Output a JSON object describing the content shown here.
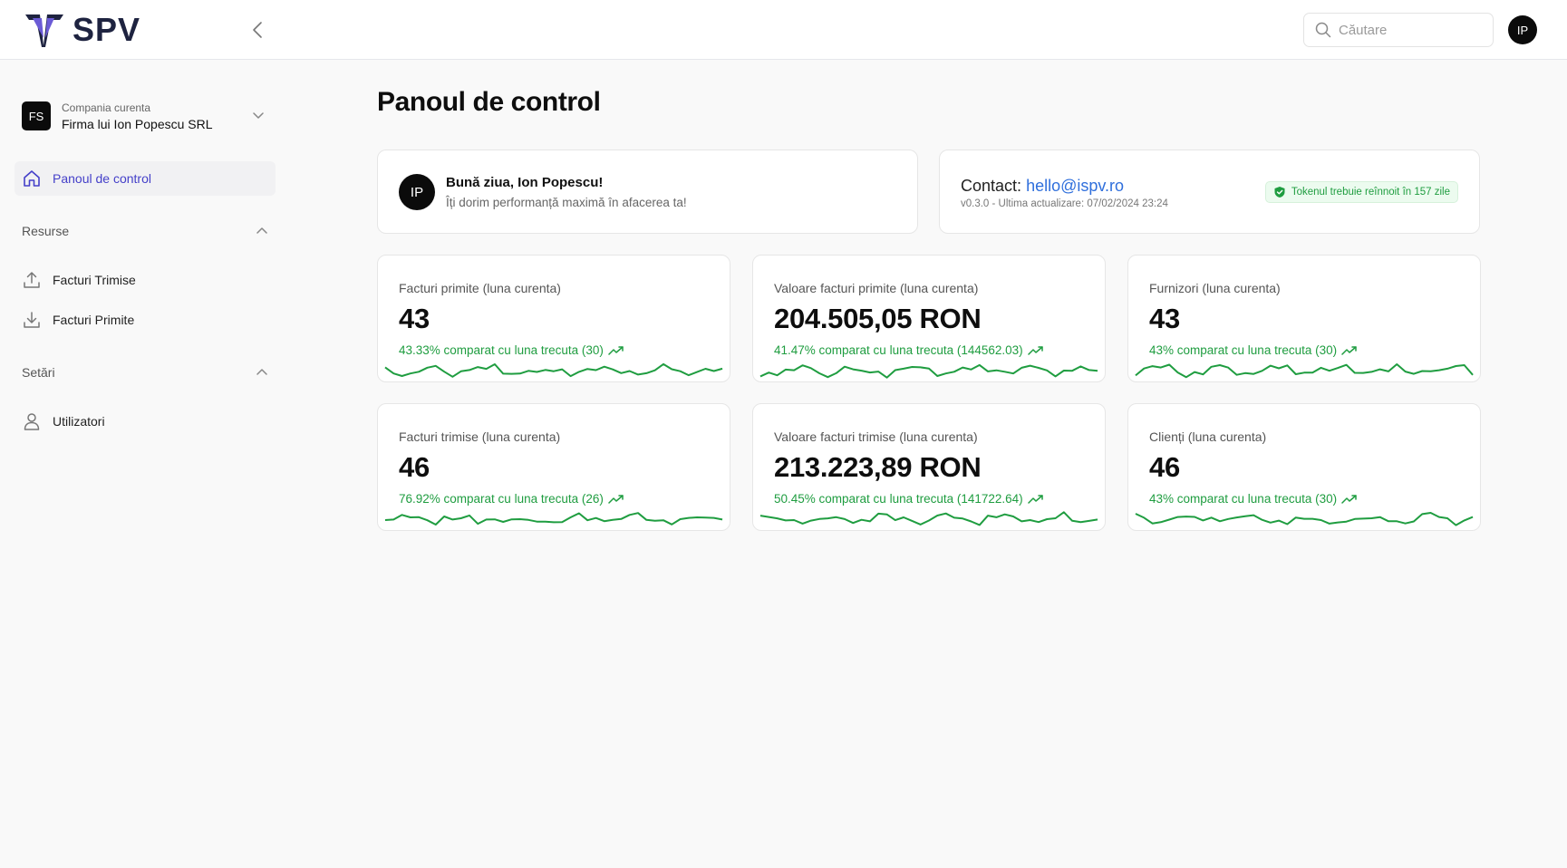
{
  "app": {
    "logo_text": "SPV"
  },
  "search": {
    "placeholder": "Căutare"
  },
  "user": {
    "initials": "IP"
  },
  "company": {
    "caption": "Compania curenta",
    "name": "Firma lui Ion Popescu SRL",
    "initials": "FS"
  },
  "sidebar": {
    "dashboard_label": "Panoul de control",
    "sections": [
      {
        "title": "Resurse",
        "items": [
          {
            "label": "Facturi Trimise",
            "icon": "upload-icon"
          },
          {
            "label": "Facturi Primite",
            "icon": "download-icon"
          }
        ]
      },
      {
        "title": "Setări",
        "items": [
          {
            "label": "Utilizatori",
            "icon": "user-icon"
          }
        ]
      }
    ]
  },
  "page": {
    "title": "Panoul de control"
  },
  "welcome": {
    "initials": "IP",
    "title": "Bună ziua, Ion Popescu!",
    "subtitle": "Îți dorim performanță maximă în afacerea ta!"
  },
  "contact": {
    "label": "Contact:",
    "email": "hello@ispv.ro",
    "version": "v0.3.0 - Ultima actualizare: 07/02/2024 23:24",
    "token_badge": "Tokenul trebuie reînnoit în 157 zile"
  },
  "colors": {
    "accent": "#4540c9",
    "positive": "#1f9d40",
    "link": "#2f6fdc"
  },
  "stats": [
    {
      "label": "Facturi primite (luna curenta)",
      "value": "43",
      "trend": "43.33% comparat cu luna trecuta (30)"
    },
    {
      "label": "Valoare facturi primite (luna curenta)",
      "value": "204.505,05 RON",
      "trend": "41.47% comparat cu luna trecuta (144562.03)"
    },
    {
      "label": "Furnizori (luna curenta)",
      "value": "43",
      "trend": "43% comparat cu luna trecuta (30)"
    },
    {
      "label": "Facturi trimise (luna curenta)",
      "value": "46",
      "trend": "76.92% comparat cu luna trecuta (26)"
    },
    {
      "label": "Valoare facturi trimise (luna curenta)",
      "value": "213.223,89 RON",
      "trend": "50.45% comparat cu luna trecuta (141722.64)"
    },
    {
      "label": "Clienți (luna curenta)",
      "value": "46",
      "trend": "43% comparat cu luna trecuta (30)"
    }
  ]
}
